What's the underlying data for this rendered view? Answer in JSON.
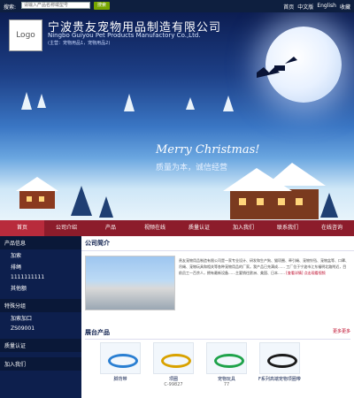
{
  "topbar": {
    "search_label": "搜索:",
    "search_placeholder": "请输入产品名称或型号",
    "search_button": "搜索",
    "links": [
      "首页",
      "中文版",
      "English",
      "收藏"
    ]
  },
  "header": {
    "logo_text": "Logo",
    "company_cn": "宁波贵友宠物用品制造有限公司",
    "company_en": "Ningbo Guiyou Pet Products Manufactory Co.,Ltd.",
    "company_sub": "(主营：宠物用品1，宠物用品2)"
  },
  "banner": {
    "merry": "Merry Christmas!",
    "slogan": "质量为本，诚信经营"
  },
  "nav": {
    "items": [
      "首页",
      "公司介绍",
      "产品",
      "视频在线",
      "质量认证",
      "加入我们",
      "联系我们",
      "在线咨询"
    ]
  },
  "sidebar": {
    "products_title": "产品信息",
    "products": [
      "加索",
      "排绳",
      "1111111111",
      "其他额"
    ],
    "special_title": "特殊分组",
    "special": [
      "加索加口",
      "ZS09001"
    ],
    "quality_title": "质量认证",
    "join_title": "加入我们"
  },
  "main": {
    "intro_title": "公司简介",
    "intro_text": "贵友宠物用品制造有限公司是一家专业设计、研发和生产狗、猫项圈、牵引绳、宠物铃铛、宠物盆等、口罩、吊绳、宠物玩具和相关等各种宠物用品的厂家。我产品已充满成…… 工厂位于宁波市江东福明北路附近，目前员工一百余人，拥有最新设备……主要销往欧洲、美国、日本……",
    "more_detail": "[查看详情]",
    "video_link": "点击观看视频",
    "products_title": "展台产品",
    "products_more": "更多更多",
    "products": [
      {
        "label": "脚背带",
        "sub": ""
      },
      {
        "label": "项圈",
        "sub": "C-99827"
      },
      {
        "label": "宠物玩具",
        "sub": "77"
      },
      {
        "label": "F系列高端宠物项圈带",
        "sub": ""
      }
    ]
  },
  "colors": {
    "nav": "#8c1c2b",
    "sidebar": "#0d1f4d",
    "topbar": "#0e1f3f",
    "accent": "#77a500"
  }
}
